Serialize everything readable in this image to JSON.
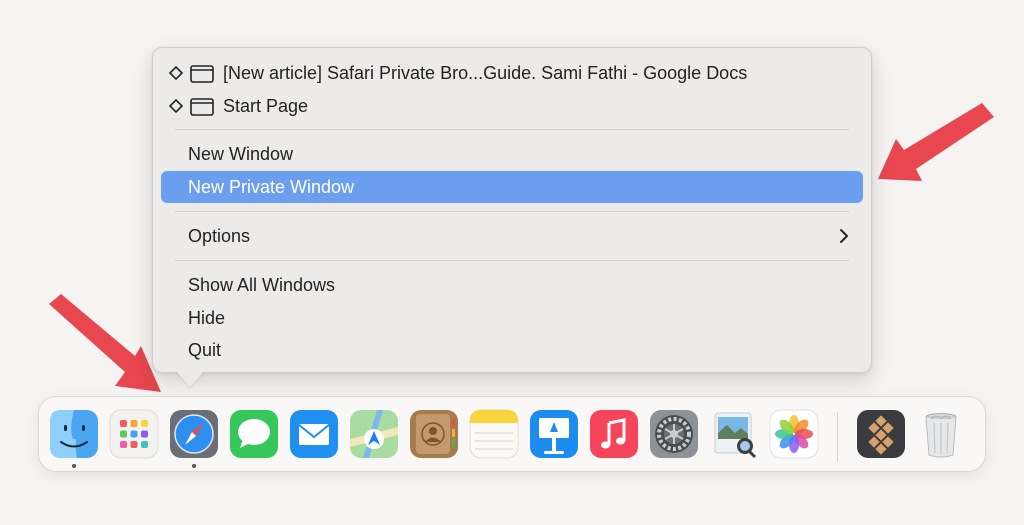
{
  "menu": {
    "windows": [
      {
        "label": "[New article] Safari Private Bro...Guide. Sami Fathi - Google Docs",
        "icon": "diamond-window-icon"
      },
      {
        "label": "Start Page",
        "icon": "diamond-window-icon"
      }
    ],
    "new_window": "New Window",
    "new_private_window": "New Private Window",
    "options": "Options",
    "show_all_windows": "Show All Windows",
    "hide": "Hide",
    "quit": "Quit",
    "highlight_color": "#6c9ef0"
  },
  "dock": {
    "apps": [
      {
        "name": "finder",
        "running": true
      },
      {
        "name": "launchpad",
        "running": false
      },
      {
        "name": "safari",
        "running": true
      },
      {
        "name": "messages",
        "running": false
      },
      {
        "name": "mail",
        "running": false
      },
      {
        "name": "maps",
        "running": false
      },
      {
        "name": "contacts",
        "running": false
      },
      {
        "name": "notes",
        "running": false
      },
      {
        "name": "keynote",
        "running": false
      },
      {
        "name": "music",
        "running": false
      },
      {
        "name": "system-settings",
        "running": false
      },
      {
        "name": "preview",
        "running": false
      },
      {
        "name": "photos",
        "running": false
      },
      {
        "name": "setapp",
        "running": false
      },
      {
        "name": "trash",
        "running": false
      }
    ]
  },
  "annotation_color": "#e8474f"
}
